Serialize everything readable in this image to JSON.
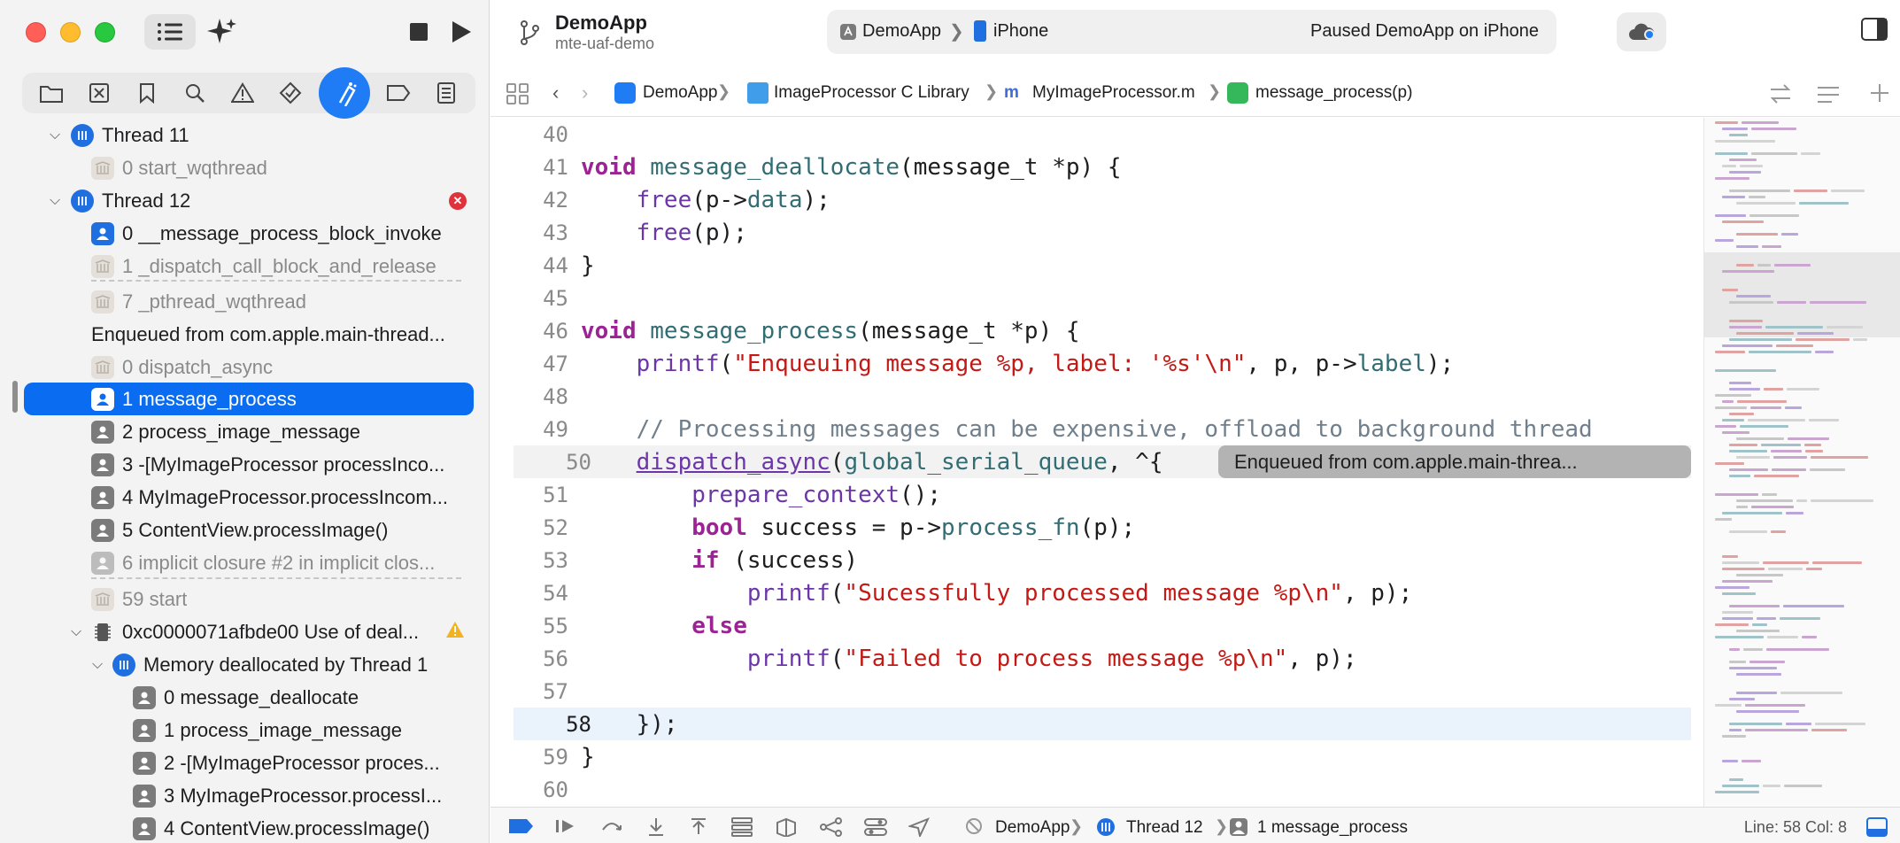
{
  "window": {
    "project_name": "DemoApp",
    "branch": "mte-uaf-demo"
  },
  "activity": {
    "scheme": "DemoApp",
    "device": "iPhone",
    "status": "Paused DemoApp on iPhone"
  },
  "jumpbar": {
    "items": [
      "DemoApp",
      "ImageProcessor C Library",
      "MyImageProcessor.m",
      "message_process(p)"
    ]
  },
  "sidebar": {
    "rows": [
      {
        "label": "Thread 11"
      },
      {
        "label": "0 start_wqthread"
      },
      {
        "label": "Thread 12"
      },
      {
        "label": "0 __message_process_block_invoke"
      },
      {
        "label": "1 _dispatch_call_block_and_release"
      },
      {
        "label": "7 _pthread_wqthread"
      },
      {
        "label": "Enqueued from com.apple.main-thread..."
      },
      {
        "label": "0 dispatch_async"
      },
      {
        "label": "1 message_process"
      },
      {
        "label": "2 process_image_message"
      },
      {
        "label": "3 -[MyImageProcessor processInco..."
      },
      {
        "label": "4 MyImageProcessor.processIncom..."
      },
      {
        "label": "5 ContentView.processImage()"
      },
      {
        "label": "6 implicit closure #2 in implicit clos..."
      },
      {
        "label": "59 start"
      },
      {
        "label": "0xc0000071afbde00 Use of deal..."
      },
      {
        "label": "Memory deallocated by Thread 1"
      },
      {
        "label": "0 message_deallocate"
      },
      {
        "label": "1 process_image_message"
      },
      {
        "label": "2 -[MyImageProcessor proces..."
      },
      {
        "label": "3 MyImageProcessor.processI..."
      },
      {
        "label": "4 ContentView.processImage()"
      }
    ]
  },
  "editor": {
    "line_numbers": [
      "40",
      "41",
      "42",
      "43",
      "44",
      "45",
      "46",
      "47",
      "48",
      "49",
      "50",
      "51",
      "52",
      "53",
      "54",
      "55",
      "56",
      "57",
      "58",
      "59",
      "60"
    ],
    "code": {
      "l41_kw": "void",
      "l41_fn": "message_deallocate",
      "l41_rest": "(message_t *p) {",
      "l42_call": "free",
      "l42_a": "(p->",
      "l42_field": "data",
      "l42_b": ");",
      "l43_call": "free",
      "l43_b": "(p);",
      "l44": "}",
      "l46_kw": "void",
      "l46_fn": "message_process",
      "l46_rest": "(message_t *p) {",
      "l47_call": "printf",
      "l47_a": "(",
      "l47_str": "\"Enqueuing message %p, label: '%s'\\n\"",
      "l47_b": ", p, p->",
      "l47_field": "label",
      "l47_c": ");",
      "l49_cmt": "// Processing messages can be expensive, offload to background thread",
      "l50_call": "dispatch_async",
      "l50_a": "(",
      "l50_arg": "global_serial_queue",
      "l50_b": ", ^{",
      "l51_call": "prepare_context",
      "l51_b": "();",
      "l52_kw": "bool",
      "l52_a": " success = p->",
      "l52_call": "process_fn",
      "l52_b": "(p);",
      "l53_kw": "if",
      "l53_b": " (success)",
      "l54_call": "printf",
      "l54_a": "(",
      "l54_str": "\"Sucessfully processed message %p\\n\"",
      "l54_b": ", p);",
      "l55_kw": "else",
      "l56_call": "printf",
      "l56_a": "(",
      "l56_str": "\"Failed to process message %p\\n\"",
      "l56_b": ", p);",
      "l58": "});",
      "l59": "}"
    },
    "annotation": "Enqueued from com.apple.main-threa..."
  },
  "debugbar": {
    "app": "DemoApp",
    "thread": "Thread 12",
    "frame": "1 message_process",
    "position": "Line: 58  Col: 8"
  },
  "colors": {
    "accent": "#0a6cf0",
    "keyword": "#9b2393",
    "string": "#c41a16",
    "function": "#326d74",
    "call": "#6c36a9",
    "comment": "#707f8c"
  }
}
